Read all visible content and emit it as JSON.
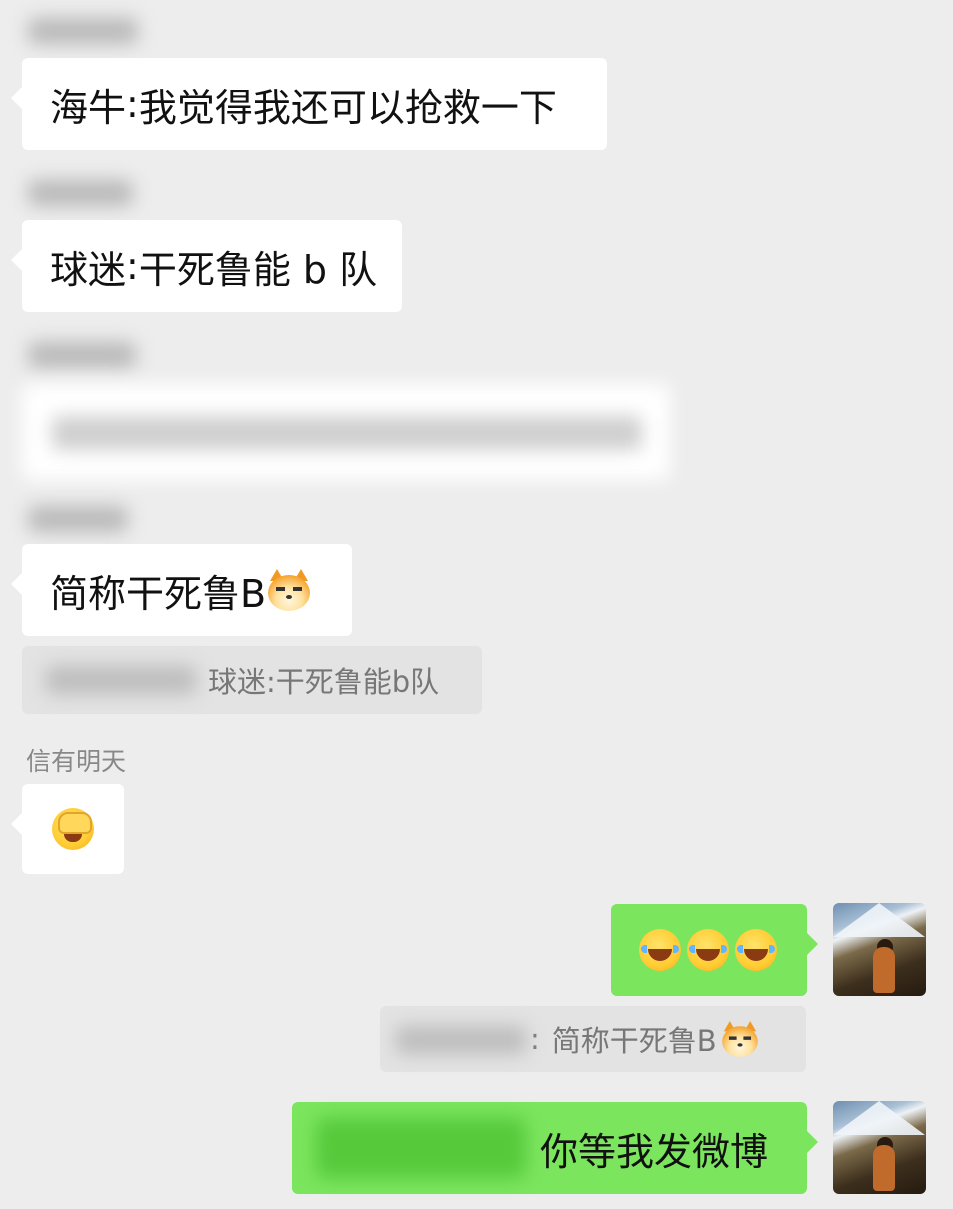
{
  "messages": [
    {
      "sender": "海牛",
      "text": "我觉得我还可以抢救一下"
    },
    {
      "sender": "球迷",
      "text": "干死鲁能 b 队"
    },
    {
      "text": "简称干死鲁B"
    },
    {
      "quote_text": "球迷:干死鲁能b队"
    },
    {
      "sender_name": "信有明天"
    }
  ],
  "quote_mine": {
    "separator": ":",
    "text": "简称干死鲁B"
  },
  "mine_last": {
    "text": "你等我发微博"
  },
  "icons": {
    "cat_emoji": "doge-cat-emoji",
    "facepalm_emoji": "facepalm-emoji",
    "laugh_emoji": "tears-of-joy-emoji",
    "avatar": "mountain-avatar"
  },
  "colors": {
    "background": "#ededed",
    "incoming_bubble": "#ffffff",
    "outgoing_bubble": "#7be55e",
    "quote_bg": "#e3e3e3"
  }
}
